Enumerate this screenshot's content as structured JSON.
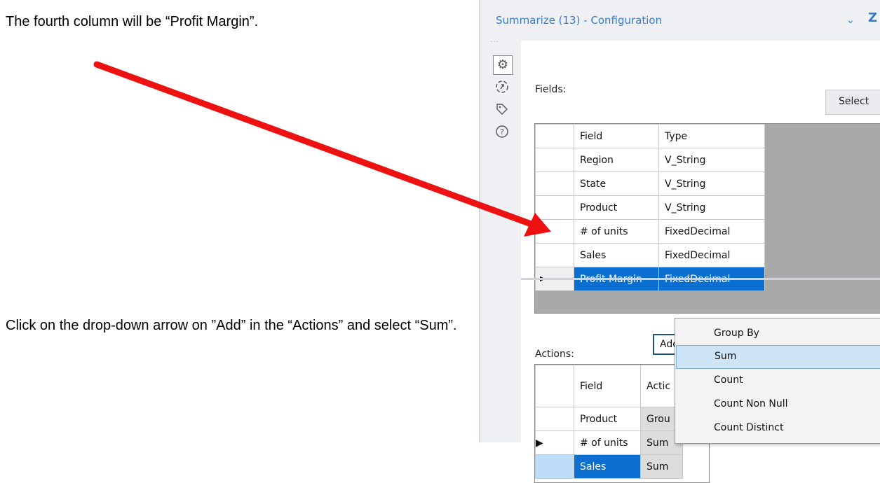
{
  "captions": {
    "top": "The fourth column will be “Profit Margin”.",
    "bottom": "Click on the drop-down arrow on ”Add” in the “Actions” and select “Sum”."
  },
  "colors": {
    "arrow": "#ee1111",
    "selection": "#0a6fd1",
    "title": "#3a7bc8"
  },
  "panel": {
    "title": "Summarize (13) - Configuration",
    "collapse_icon": "chevron-down-icon",
    "pin_icon": "Z",
    "dots": "...",
    "rail_icons": [
      "gear-icon",
      "navigate-icon",
      "tag-icon",
      "help-icon"
    ],
    "fields_label": "Fields:",
    "select_label": "Select",
    "fields_headers": {
      "field": "Field",
      "type": "Type"
    },
    "fields_rows": [
      {
        "field": "Region",
        "type": "V_String"
      },
      {
        "field": "State",
        "type": "V_String"
      },
      {
        "field": "Product",
        "type": "V_String"
      },
      {
        "field": "# of units",
        "type": "FixedDecimal"
      },
      {
        "field": "Sales",
        "type": "FixedDecimal"
      },
      {
        "field": "Profit Margin",
        "type": "FixedDecimal"
      }
    ],
    "actions_label": "Actions:",
    "add_label": "Add",
    "actions_headers": {
      "field": "Field",
      "action": "Actic"
    },
    "actions_rows": [
      {
        "field": "Product",
        "action": "Grou"
      },
      {
        "field": "# of units",
        "action": "Sum"
      },
      {
        "field": "Sales",
        "action": "Sum"
      }
    ],
    "dropdown_items": [
      "Group By",
      "Sum",
      "Count",
      "Count Non Null",
      "Count Distinct"
    ]
  }
}
